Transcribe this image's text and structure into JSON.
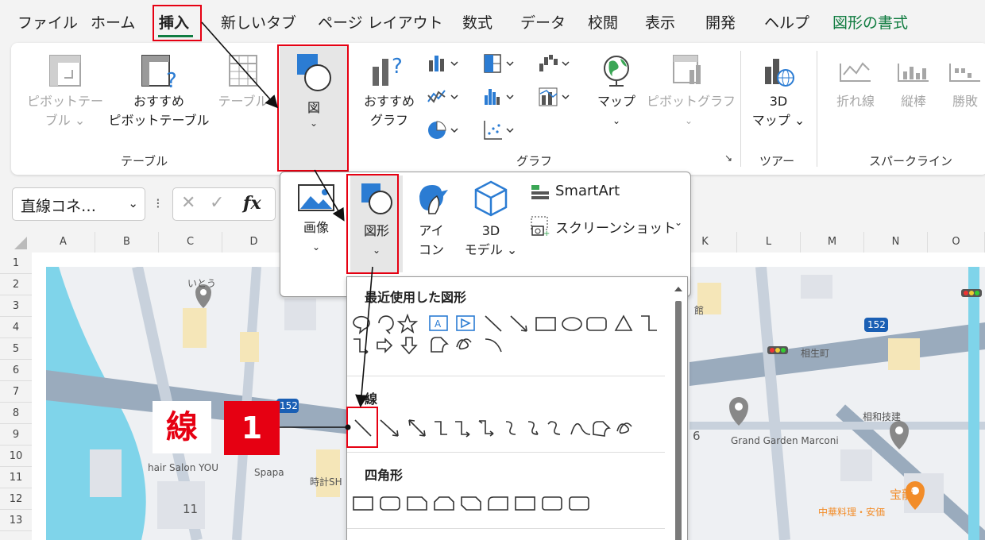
{
  "menu": {
    "file": "ファイル",
    "home": "ホーム",
    "insert": "挿入",
    "new_tab": "新しいタブ",
    "page_layout": "ページ レイアウト",
    "formulas": "数式",
    "data": "データ",
    "review": "校閲",
    "view": "表示",
    "developer": "開発",
    "help": "ヘルプ",
    "shape_format": "図形の書式"
  },
  "ribbon": {
    "pivot_table": [
      "ピボットテー",
      "ブル ⌄"
    ],
    "recommended_pivot": [
      "おすすめ",
      "ピボットテーブル"
    ],
    "table": "テーブル",
    "illustrations": "図",
    "recommended_charts": [
      "おすすめ",
      "グラフ"
    ],
    "maps": "マップ",
    "pivot_chart": "ピボットグラフ",
    "map3d": [
      "3D",
      "マップ ⌄"
    ],
    "spark_line": "折れ線",
    "spark_column": "縦棒",
    "spark_winloss": "勝敗",
    "group_table": "テーブル",
    "group_chart": "グラフ",
    "group_tour": "ツアー",
    "group_sparkline": "スパークライン"
  },
  "formula_bar": {
    "name_box": "直線コネ…",
    "fx": "fx"
  },
  "columns": [
    "A",
    "B",
    "C",
    "D",
    "K",
    "L",
    "M",
    "N",
    "O"
  ],
  "rows": [
    "1",
    "2",
    "3",
    "4",
    "5",
    "6",
    "7",
    "8",
    "9",
    "10",
    "11",
    "12",
    "13"
  ],
  "illustrations_menu": {
    "picture": "画像",
    "shapes": "図形",
    "icons": [
      "アイ",
      "コン"
    ],
    "models3d": [
      "3D",
      "モデル ⌄"
    ],
    "smartart": "SmartArt",
    "screenshot": "スクリーンショット"
  },
  "gallery": {
    "recent": "最近使用した図形",
    "lines": "線",
    "rectangles": "四角形"
  },
  "map_labels": {
    "itou": "いとう",
    "hair_salon": "hair Salon YOU",
    "spapa": "Spapa",
    "tokei": "時計SH",
    "num11": "11",
    "num6": "6",
    "grand_garden": "Grand Garden Marconi",
    "aioi": "相生町",
    "aiwa": "相和技建",
    "route152a": "152",
    "route152b": "152",
    "hourai": "宝龍",
    "chuka": "中華料理・安価",
    "kaikan": "館"
  },
  "annotations": {
    "label": "線",
    "step": "1"
  },
  "colors": {
    "accent_green": "#107c41",
    "highlight_red": "#e60012",
    "map_water": "#7fd4ea",
    "map_road": "#9aabbd"
  }
}
